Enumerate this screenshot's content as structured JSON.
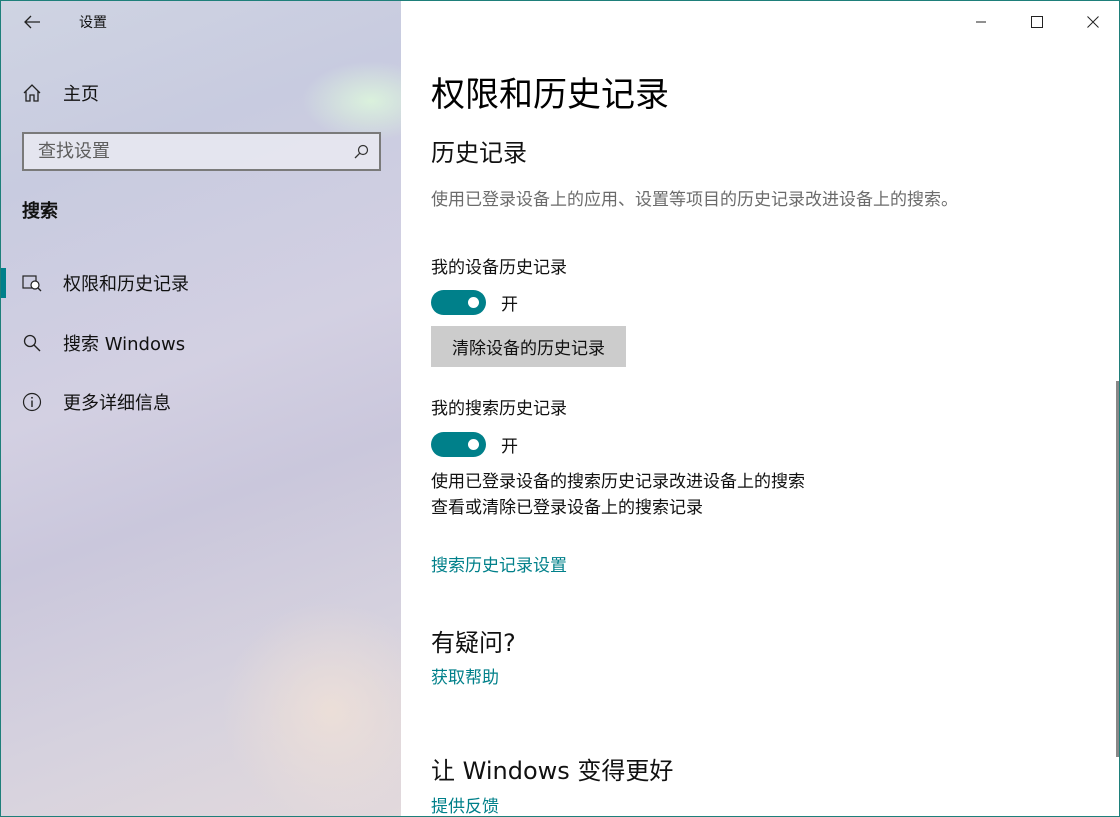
{
  "window": {
    "app_title": "设置"
  },
  "sidebar": {
    "home_label": "主页",
    "search_placeholder": "查找设置",
    "section_title": "搜索",
    "items": [
      {
        "label": "权限和历史记录",
        "icon": "shield-search-icon",
        "selected": true
      },
      {
        "label": "搜索 Windows",
        "icon": "search-icon",
        "selected": false
      },
      {
        "label": "更多详细信息",
        "icon": "info-icon",
        "selected": false
      }
    ]
  },
  "content": {
    "page_title": "权限和历史记录",
    "history_heading": "历史记录",
    "history_desc": "使用已登录设备上的应用、设置等项目的历史记录改进设备上的搜索。",
    "device_history_label": "我的设备历史记录",
    "device_history_state": "开",
    "clear_button_label": "清除设备的历史记录",
    "search_history_label": "我的搜索历史记录",
    "search_history_state": "开",
    "search_history_line1": "使用已登录设备的搜索历史记录改进设备上的搜索",
    "search_history_line2": "查看或清除已登录设备上的搜索记录",
    "search_history_settings_link": "搜索历史记录设置",
    "questions_heading": "有疑问?",
    "get_help_link": "获取帮助",
    "improve_heading": "让 Windows 变得更好",
    "feedback_link": "提供反馈"
  },
  "colors": {
    "accent": "#00808a",
    "toggle_on": "#00808a",
    "button_bg": "#cccccc"
  }
}
